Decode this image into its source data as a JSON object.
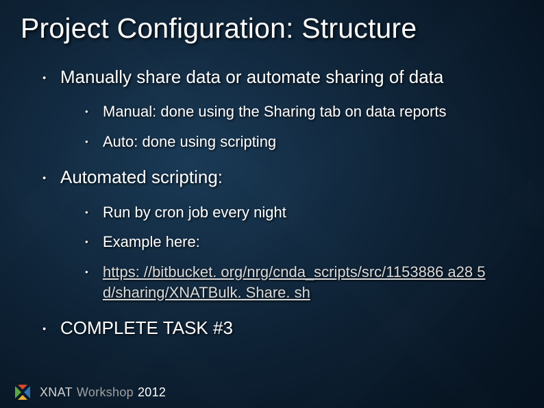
{
  "title": "Project Configuration: Structure",
  "bullets": {
    "manual_share": "Manually share data or automate sharing of data",
    "manual_sub1": "Manual: done using the Sharing tab on data reports",
    "manual_sub2": "Auto: done using scripting",
    "auto_scripting": "Automated scripting:",
    "auto_sub1": "Run by cron job every night",
    "auto_sub2": "Example here:",
    "auto_link": "https: //bitbucket. org/nrg/cnda_scripts/src/1153886 a28 5 d/sharing/XNATBulk. Share. sh",
    "complete_task": "COMPLETE TASK #3"
  },
  "footer": {
    "brand": "XNAT",
    "workshop": "Workshop",
    "year": "2012"
  }
}
